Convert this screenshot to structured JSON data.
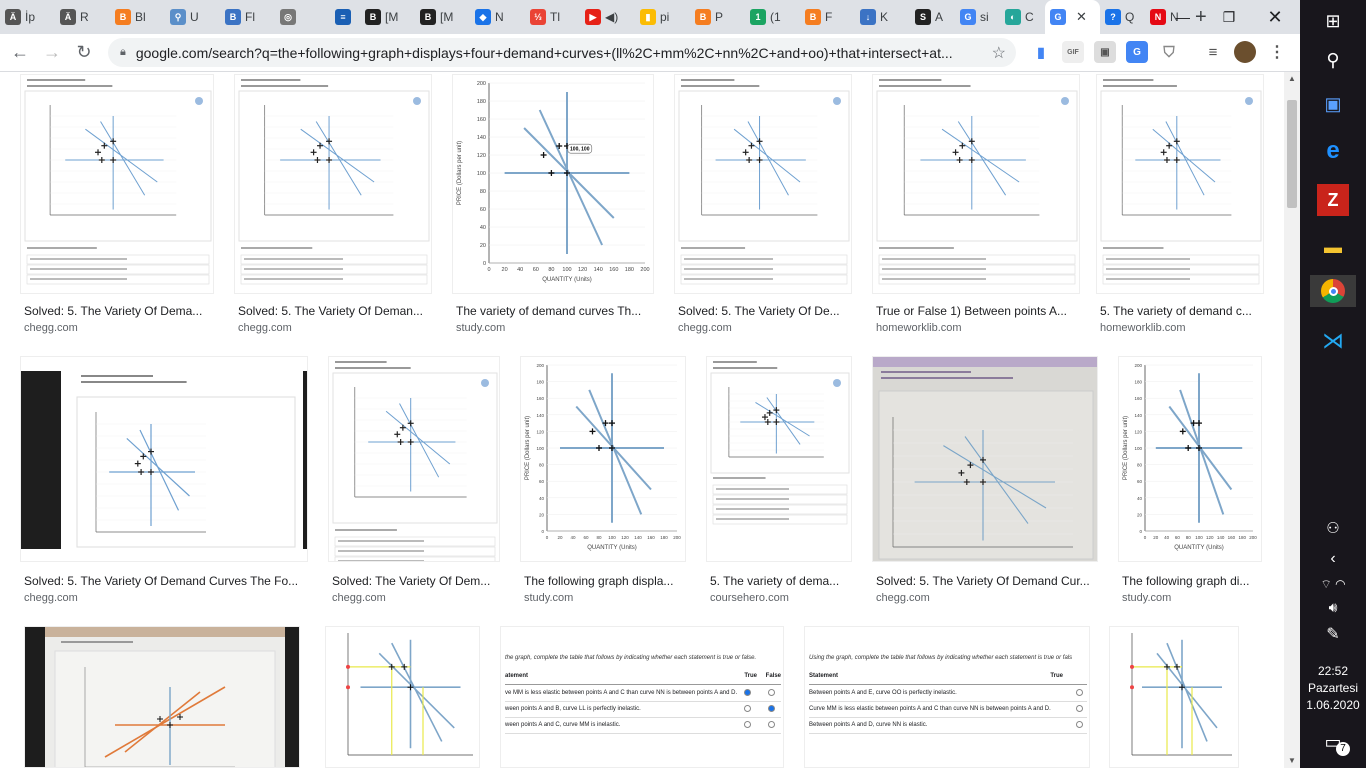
{
  "tabs": [
    {
      "label": "İp",
      "color": "#555555",
      "glyph": "Ä"
    },
    {
      "label": "R",
      "color": "#555555",
      "glyph": "Ä"
    },
    {
      "label": "Bl",
      "color": "#f57d20",
      "glyph": "B"
    },
    {
      "label": "U",
      "color": "#5b8fc9",
      "glyph": "⚲"
    },
    {
      "label": "Fl",
      "color": "#3b73c4",
      "glyph": "B"
    },
    {
      "label": "",
      "color": "#777777",
      "glyph": "◎"
    },
    {
      "label": "",
      "color": "#1a5fb4",
      "glyph": "≡"
    },
    {
      "label": "[M",
      "color": "#222222",
      "glyph": "B"
    },
    {
      "label": "[M",
      "color": "#222222",
      "glyph": "B"
    },
    {
      "label": "N",
      "color": "#1a73e8",
      "glyph": "◆"
    },
    {
      "label": "Tl",
      "color": "#ea4335",
      "glyph": "⅓"
    },
    {
      "label": "◀)",
      "color": "#e62117",
      "glyph": "▶"
    },
    {
      "label": "pi",
      "color": "#fbbc04",
      "glyph": "▮"
    },
    {
      "label": "P",
      "color": "#f57d20",
      "glyph": "B"
    },
    {
      "label": "(1",
      "color": "#1ba462",
      "glyph": "1"
    },
    {
      "label": "F",
      "color": "#f57d20",
      "glyph": "B"
    },
    {
      "label": "K",
      "color": "#3b73c4",
      "glyph": "↓"
    },
    {
      "label": "A",
      "color": "#222222",
      "glyph": "S"
    },
    {
      "label": "si",
      "color": "#4285f4",
      "glyph": "G"
    },
    {
      "label": "C",
      "color": "#26a69a",
      "glyph": "◐"
    },
    {
      "label": "",
      "color": "#4285f4",
      "glyph": "G",
      "active": true
    },
    {
      "label": "Q",
      "color": "#1a73e8",
      "glyph": "?"
    },
    {
      "label": "N",
      "color": "#e50914",
      "glyph": "N"
    }
  ],
  "url": "google.com/search?q=the+following+graph+displays+four+demand+curves+(ll%2C+mm%2C+nn%2C+and+oo)+that+intersect+at...",
  "results": [
    {
      "title": "Solved: 5. The Variety Of Dema...",
      "source": "chegg.com"
    },
    {
      "title": "Solved: 5. The Variety Of Deman...",
      "source": "chegg.com"
    },
    {
      "title": "The variety of demand curves Th...",
      "source": "study.com"
    },
    {
      "title": "Solved: 5. The Variety Of De...",
      "source": "chegg.com"
    },
    {
      "title": "True or False 1) Between points A...",
      "source": "homeworklib.com"
    },
    {
      "title": "5. The variety of demand c...",
      "source": "homeworklib.com"
    },
    {
      "title": "Solved: 5. The Variety Of Demand Curves The Fo...",
      "source": "chegg.com"
    },
    {
      "title": "Solved: The Variety Of Dem...",
      "source": "chegg.com"
    },
    {
      "title": "The following graph displa...",
      "source": "study.com"
    },
    {
      "title": "5. The variety of dema...",
      "source": "coursehero.com"
    },
    {
      "title": "Solved: 5. The Variety Of Demand Cur...",
      "source": "chegg.com"
    },
    {
      "title": "The following graph di...",
      "source": "study.com"
    }
  ],
  "big_chart": {
    "ylabel": "PRICE (Dollars per unit)",
    "xlabel": "QUANTITY (Units)",
    "yticks": [
      "200",
      "180",
      "160",
      "140",
      "120",
      "100",
      "80",
      "60",
      "40",
      "20",
      "0"
    ],
    "xticks": [
      "0",
      "20",
      "40",
      "60",
      "80",
      "100",
      "120",
      "140",
      "160",
      "180",
      "200"
    ],
    "callout": "100, 100"
  },
  "row3_text": {
    "instr1": "the graph, complete the table that follows by indicating whether each statement is true or false.",
    "col_statement": "atement",
    "col_true": "True",
    "col_false": "False",
    "rows1": [
      "ve MM is less elastic between points A and C than curve NN is between points A and D.",
      "ween points A and B, curve LL is perfectly inelastic.",
      "ween points A and C, curve MM is inelastic."
    ],
    "instr2": "Using the graph, complete the table that follows by indicating whether each statement is true or fals",
    "col_statement2": "Statement",
    "rows2": [
      "Between points A and E, curve OO is perfectly inelastic.",
      "Curve MM is less elastic between points A and C than curve NN is between points A and D.",
      "Between points A and D, curve NN is elastic."
    ]
  },
  "clock": {
    "time": "22:52",
    "day": "Pazartesi",
    "date": "1.06.2020"
  },
  "notif_count": "7"
}
